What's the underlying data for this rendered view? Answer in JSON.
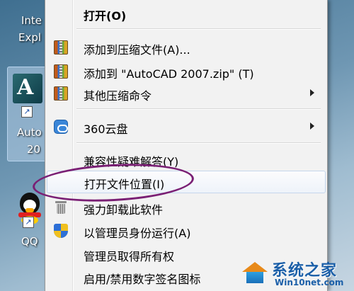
{
  "desktop": {
    "icons": [
      {
        "label_line1": "Inte",
        "label_line2": "Expl"
      },
      {
        "label_line1": "Auto",
        "label_line2": "20"
      },
      {
        "label_line1": "QQ"
      }
    ]
  },
  "context_menu": {
    "items": [
      {
        "label": "打开(O)",
        "icon": "none"
      },
      {
        "label": "添加到压缩文件(A)...",
        "icon": "winrar-archive-icon"
      },
      {
        "label": "添加到 \"AutoCAD 2007.zip\" (T)",
        "icon": "winrar-archive-icon"
      },
      {
        "label": "其他压缩命令",
        "icon": "winrar-archive-icon",
        "submenu": true
      },
      {
        "label": "360云盘",
        "icon": "cloud-disk-icon",
        "submenu": true
      },
      {
        "label": "兼容性疑难解答(Y)",
        "icon": "none"
      },
      {
        "label": "打开文件位置(I)",
        "icon": "none",
        "highlighted": true
      },
      {
        "label": "强力卸载此软件",
        "icon": "trash-icon"
      },
      {
        "label": "以管理员身份运行(A)",
        "icon": "uac-shield-icon"
      },
      {
        "label": "管理员取得所有权",
        "icon": "none"
      },
      {
        "label": "启用/禁用数字签名图标",
        "icon": "none"
      }
    ]
  },
  "watermark": {
    "title": "系统之家",
    "url": "Win10net.com"
  },
  "colors": {
    "highlight_ellipse": "#7a1f74",
    "menu_background": "#f2f2f2"
  }
}
